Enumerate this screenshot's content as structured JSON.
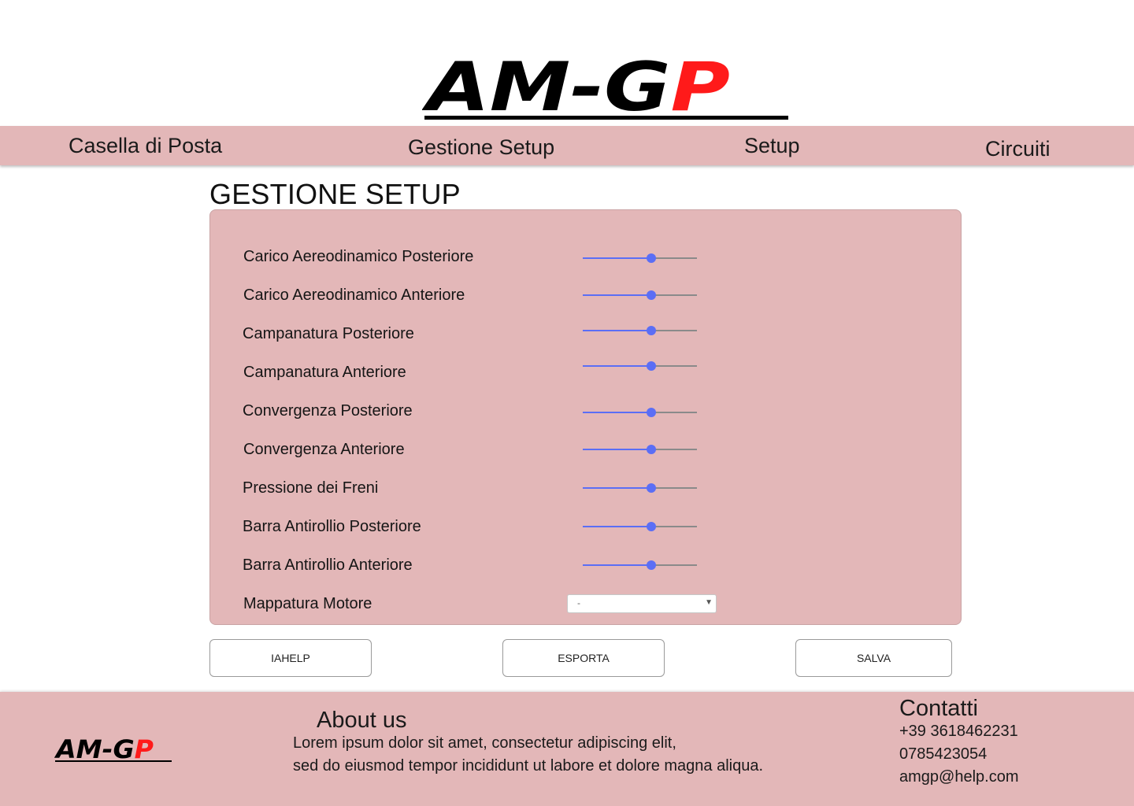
{
  "brand": {
    "logo_text_black": "AM-G",
    "logo_text_red": "P",
    "logo_red_color": "#ff1a1a"
  },
  "nav": {
    "items": [
      {
        "label": "Casella di Posta"
      },
      {
        "label": "Gestione Setup"
      },
      {
        "label": "Setup"
      },
      {
        "label": "Circuiti"
      }
    ]
  },
  "page": {
    "title": "GESTIONE SETUP"
  },
  "setup": {
    "sliders": [
      {
        "label": "Carico Aereodinamico Posteriore",
        "value": 0.6
      },
      {
        "label": "Carico Aereodinamico Anteriore",
        "value": 0.6
      },
      {
        "label": "Campanatura Posteriore",
        "value": 0.6
      },
      {
        "label": "Campanatura Anteriore",
        "value": 0.6
      },
      {
        "label": "Convergenza Posteriore",
        "value": 0.6
      },
      {
        "label": "Convergenza Anteriore",
        "value": 0.6
      },
      {
        "label": "Pressione dei Freni",
        "value": 0.6
      },
      {
        "label": "Barra Antirollio Posteriore",
        "value": 0.6
      },
      {
        "label": "Barra Antirollio Anteriore",
        "value": 0.6
      }
    ],
    "engine_map": {
      "label": "Mappatura Motore",
      "selected": "-"
    }
  },
  "actions": {
    "help_label": "IAHELP",
    "export_label": "ESPORTA",
    "save_label": "SALVA"
  },
  "footer": {
    "about_title": "About us",
    "about_line1": "Lorem ipsum dolor sit amet, consectetur adipiscing elit,",
    "about_line2": "sed do eiusmod  tempor incididunt ut labore et dolore magna aliqua.",
    "contact_title": "Contatti",
    "phone1": "+39 3618462231",
    "phone2": "0785423054",
    "email": "amgp@help.com"
  },
  "colors": {
    "accent": "#5b6ef5",
    "panel_bg": "#e3b7b8"
  }
}
